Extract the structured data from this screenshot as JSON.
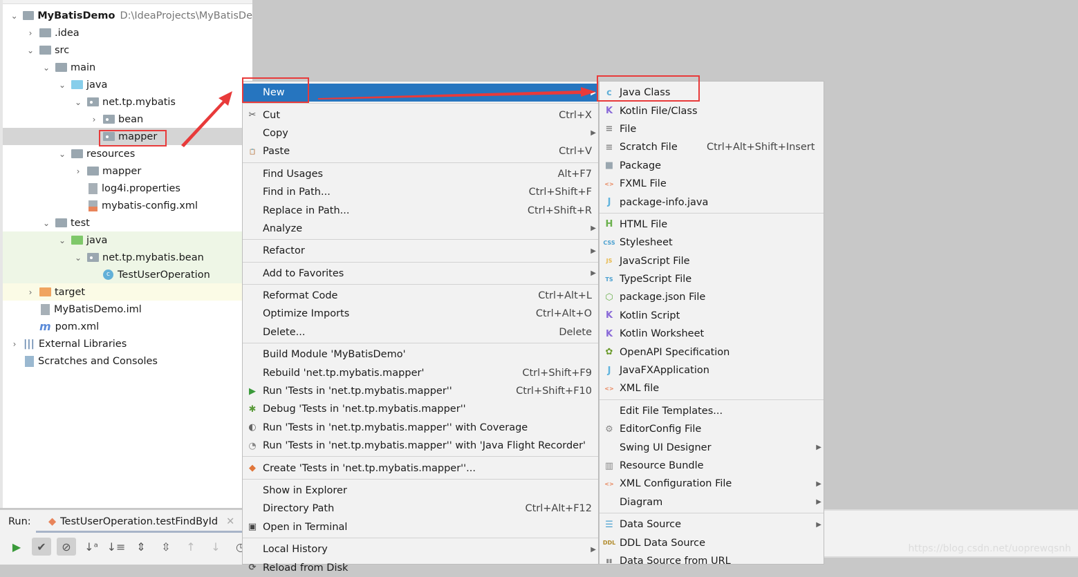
{
  "tree": {
    "rows": [
      {
        "label": "MyBatisDemo",
        "path": "D:\\IdeaProjects\\MyBatisDe",
        "indent": 0,
        "chev": "v",
        "icon": "module",
        "bold": true
      },
      {
        "label": ".idea",
        "indent": 1,
        "chev": ">",
        "icon": "gray"
      },
      {
        "label": "src",
        "indent": 1,
        "chev": "v",
        "icon": "gray"
      },
      {
        "label": "main",
        "indent": 2,
        "chev": "v",
        "icon": "gray"
      },
      {
        "label": "java",
        "indent": 3,
        "chev": "v",
        "icon": "blue"
      },
      {
        "label": "net.tp.mybatis",
        "indent": 4,
        "chev": "v",
        "icon": "pkg"
      },
      {
        "label": "bean",
        "indent": 5,
        "chev": ">",
        "icon": "pkg"
      },
      {
        "label": "mapper",
        "indent": 5,
        "chev": "",
        "icon": "pkg",
        "state": "sel"
      },
      {
        "label": "resources",
        "indent": 3,
        "chev": "v",
        "icon": "gray"
      },
      {
        "label": "mapper",
        "indent": 4,
        "chev": ">",
        "icon": "gray"
      },
      {
        "label": "log4i.properties",
        "indent": 4,
        "chev": "",
        "icon": "doc"
      },
      {
        "label": "mybatis-config.xml",
        "indent": 4,
        "chev": "",
        "icon": "xml"
      },
      {
        "label": "test",
        "indent": 2,
        "chev": "v",
        "icon": "gray"
      },
      {
        "label": "java",
        "indent": 3,
        "chev": "v",
        "icon": "green",
        "state": "green"
      },
      {
        "label": "net.tp.mybatis.bean",
        "indent": 4,
        "chev": "v",
        "icon": "pkg",
        "state": "green"
      },
      {
        "label": "TestUserOperation",
        "indent": 5,
        "chev": "",
        "icon": "class",
        "state": "green"
      },
      {
        "label": "target",
        "indent": 1,
        "chev": ">",
        "icon": "orange",
        "state": "yellow"
      },
      {
        "label": "MyBatisDemo.iml",
        "indent": 1,
        "chev": "",
        "icon": "doc"
      },
      {
        "label": "pom.xml",
        "indent": 1,
        "chev": "",
        "icon": "maven"
      },
      {
        "label": "External Libraries",
        "indent": 0,
        "chev": ">",
        "icon": "libs"
      },
      {
        "label": "Scratches and Consoles",
        "indent": 0,
        "chev": "",
        "icon": "scratch"
      }
    ]
  },
  "run": {
    "label": "Run:",
    "tab": "TestUserOperation.testFindById"
  },
  "context_menu": [
    {
      "label": "New",
      "arrow": true,
      "highlighted": true
    },
    {
      "sep": true
    },
    {
      "label": "Cut",
      "shortcut": "Ctrl+X",
      "icon": "scissors-icon",
      "glyph": "✂"
    },
    {
      "label": "Copy",
      "arrow": true
    },
    {
      "label": "Paste",
      "shortcut": "Ctrl+V",
      "icon": "clipboard-icon",
      "glyph": "📋"
    },
    {
      "sep": true
    },
    {
      "label": "Find Usages",
      "shortcut": "Alt+F7"
    },
    {
      "label": "Find in Path...",
      "shortcut": "Ctrl+Shift+F"
    },
    {
      "label": "Replace in Path...",
      "shortcut": "Ctrl+Shift+R"
    },
    {
      "label": "Analyze",
      "arrow": true
    },
    {
      "sep": true
    },
    {
      "label": "Refactor",
      "arrow": true
    },
    {
      "sep": true
    },
    {
      "label": "Add to Favorites",
      "arrow": true
    },
    {
      "sep": true
    },
    {
      "label": "Reformat Code",
      "shortcut": "Ctrl+Alt+L"
    },
    {
      "label": "Optimize Imports",
      "shortcut": "Ctrl+Alt+O"
    },
    {
      "label": "Delete...",
      "shortcut": "Delete"
    },
    {
      "sep": true
    },
    {
      "label": "Build Module 'MyBatisDemo'"
    },
    {
      "label": "Rebuild 'net.tp.mybatis.mapper'",
      "shortcut": "Ctrl+Shift+F9"
    },
    {
      "label": "Run 'Tests in 'net.tp.mybatis.mapper''",
      "shortcut": "Ctrl+Shift+F10",
      "icon": "run-icon",
      "glyph": "▶",
      "color": "#3a9a3a"
    },
    {
      "label": "Debug 'Tests in 'net.tp.mybatis.mapper''",
      "icon": "debug-icon",
      "glyph": "✱",
      "color": "#5a9a3a"
    },
    {
      "label": "Run 'Tests in 'net.tp.mybatis.mapper'' with Coverage",
      "icon": "coverage-icon",
      "glyph": "◐",
      "color": "#666"
    },
    {
      "label": "Run 'Tests in 'net.tp.mybatis.mapper'' with 'Java Flight Recorder'",
      "icon": "profiler-icon",
      "glyph": "◔",
      "color": "#888"
    },
    {
      "sep": true
    },
    {
      "label": "Create 'Tests in 'net.tp.mybatis.mapper''...",
      "icon": "create-test-icon",
      "glyph": "◆",
      "color": "#e0763a"
    },
    {
      "sep": true
    },
    {
      "label": "Show in Explorer"
    },
    {
      "label": "Directory Path",
      "shortcut": "Ctrl+Alt+F12"
    },
    {
      "label": "Open in Terminal",
      "icon": "terminal-icon",
      "glyph": "▣",
      "color": "#444"
    },
    {
      "sep": true
    },
    {
      "label": "Local History",
      "arrow": true
    },
    {
      "label": "Reload from Disk",
      "icon": "reload-icon",
      "glyph": "⟳",
      "color": "#555"
    }
  ],
  "new_submenu": [
    {
      "label": "Java Class",
      "icon": "java-class-icon",
      "glyph": "c",
      "color": "#62b0d8"
    },
    {
      "label": "Kotlin File/Class",
      "icon": "kotlin-file-icon",
      "glyph": "K",
      "color": "#8a6ad8"
    },
    {
      "label": "File",
      "icon": "file-icon",
      "glyph": "≡",
      "color": "#888"
    },
    {
      "label": "Scratch File",
      "shortcut": "Ctrl+Alt+Shift+Insert",
      "icon": "scratch-file-icon",
      "glyph": "≡",
      "color": "#888"
    },
    {
      "label": "Package",
      "icon": "package-icon",
      "glyph": "■",
      "color": "#9aa7b0"
    },
    {
      "label": "FXML File",
      "icon": "fxml-file-icon",
      "glyph": "<>",
      "color": "#e8845a"
    },
    {
      "label": "package-info.java",
      "icon": "package-info-icon",
      "glyph": "J",
      "color": "#5fb3dd"
    },
    {
      "sep": true
    },
    {
      "label": "HTML File",
      "icon": "html-file-icon",
      "glyph": "H",
      "color": "#6ab04c"
    },
    {
      "label": "Stylesheet",
      "icon": "css-file-icon",
      "glyph": "CSS",
      "color": "#4aa0d0"
    },
    {
      "label": "JavaScript File",
      "icon": "js-file-icon",
      "glyph": "JS",
      "color": "#e8b84a"
    },
    {
      "label": "TypeScript File",
      "icon": "ts-file-icon",
      "glyph": "TS",
      "color": "#4aa0d0"
    },
    {
      "label": "package.json File",
      "icon": "nodejs-icon",
      "glyph": "⬡",
      "color": "#6ab04c"
    },
    {
      "label": "Kotlin Script",
      "icon": "kotlin-script-icon",
      "glyph": "K",
      "color": "#8a6ad8"
    },
    {
      "label": "Kotlin Worksheet",
      "icon": "kotlin-worksheet-icon",
      "glyph": "K",
      "color": "#8a6ad8"
    },
    {
      "label": "OpenAPI Specification",
      "icon": "openapi-icon",
      "glyph": "✿",
      "color": "#6a9a2a"
    },
    {
      "label": "JavaFXApplication",
      "icon": "javafx-icon",
      "glyph": "J",
      "color": "#5fb3dd"
    },
    {
      "label": "XML file",
      "icon": "xml-file-icon",
      "glyph": "<>",
      "color": "#e8845a"
    },
    {
      "sep": true
    },
    {
      "label": "Edit File Templates..."
    },
    {
      "label": "EditorConfig File",
      "icon": "gear-icon",
      "glyph": "⚙",
      "color": "#888"
    },
    {
      "label": "Swing UI Designer",
      "arrow": true
    },
    {
      "label": "Resource Bundle",
      "icon": "resource-bundle-icon",
      "glyph": "▥",
      "color": "#888"
    },
    {
      "label": "XML Configuration File",
      "arrow": true,
      "icon": "xml-config-icon",
      "glyph": "<>",
      "color": "#e8845a"
    },
    {
      "label": "Diagram",
      "arrow": true
    },
    {
      "sep": true
    },
    {
      "label": "Data Source",
      "arrow": true,
      "icon": "database-icon",
      "glyph": "☰",
      "color": "#4aa0d0"
    },
    {
      "label": "DDL Data Source",
      "icon": "ddl-icon",
      "glyph": "DDL",
      "color": "#b08a2a"
    },
    {
      "label": "Data Source from URL",
      "icon": "url-datasource-icon",
      "glyph": "▮▮",
      "color": "#888"
    }
  ],
  "watermark": "https://blog.csdn.net/uoprewqsnh",
  "colors": {
    "highlight": "#2675bf",
    "annotation": "#e83a3a",
    "menu_bg": "#f2f2f2"
  }
}
